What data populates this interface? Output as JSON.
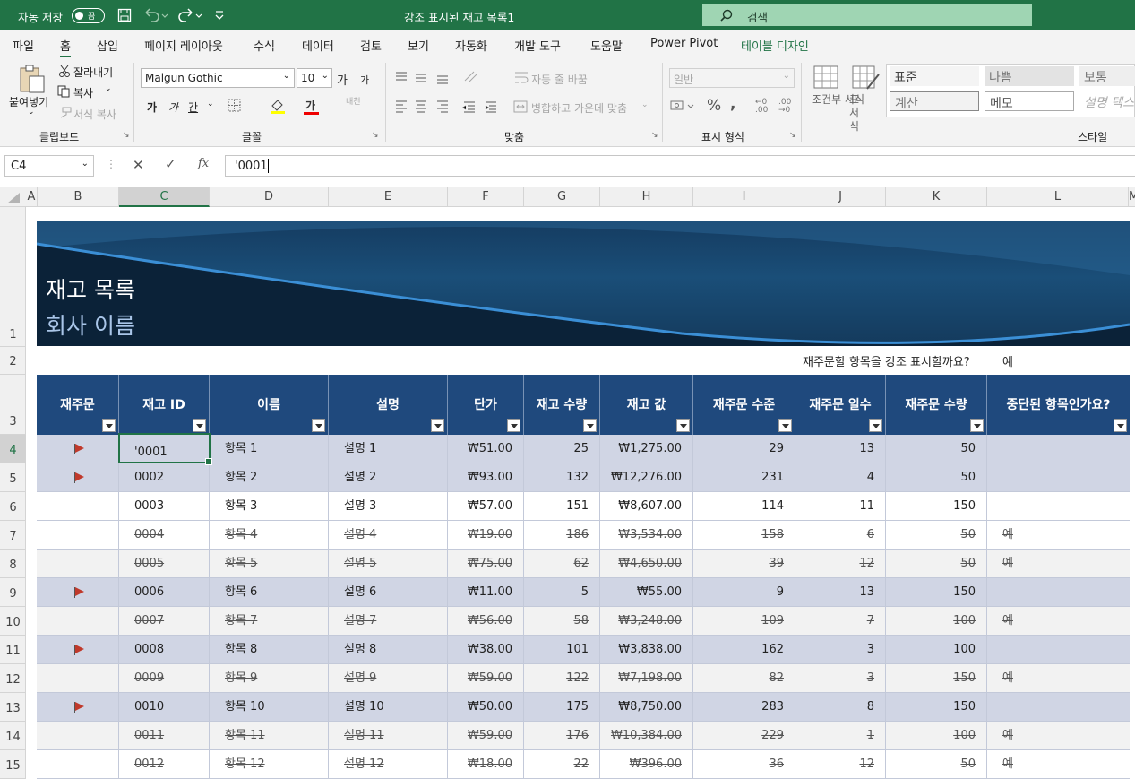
{
  "titlebar": {
    "autosave_label": "자동 저장",
    "autosave_state": "끔",
    "doc_title": "강조 표시된 재고 목록1",
    "search_placeholder": "검색"
  },
  "menu": [
    "파일",
    "홈",
    "삽입",
    "페이지 레이아웃",
    "수식",
    "데이터",
    "검토",
    "보기",
    "자동화",
    "개발 도구",
    "도움말",
    "Power Pivot",
    "테이블 디자인"
  ],
  "ribbon": {
    "clipboard": {
      "paste": "붙여넣기",
      "cut": "잘라내기",
      "copy": "복사",
      "format_painter": "서식 복사",
      "group": "클립보드"
    },
    "font": {
      "name": "Malgun Gothic",
      "size": "10",
      "grow": "가",
      "shrink": "가",
      "bold": "가",
      "italic": "가",
      "underline": "간",
      "font_color": "가",
      "phonetic": "내천",
      "group": "글꼴"
    },
    "alignment": {
      "wrap": "자동 줄 바꿈",
      "merge": "병합하고 가운데 맞춤",
      "group": "맞춤"
    },
    "number": {
      "format": "일반",
      "group": "표시 형식"
    },
    "styles": {
      "conditional": "조건부 서식",
      "table": "표 서식",
      "normal": "표준",
      "bad": "나쁨",
      "good": "보통",
      "calc": "계산",
      "memo": "메모",
      "explain": "설명 텍스",
      "group": "스타일"
    }
  },
  "formula_bar": {
    "name_box": "C4",
    "value": "'0001"
  },
  "columns": [
    "A",
    "B",
    "C",
    "D",
    "E",
    "F",
    "G",
    "H",
    "I",
    "J",
    "K",
    "L",
    "M"
  ],
  "rows": [
    "1",
    "2",
    "3",
    "4",
    "5",
    "6",
    "7",
    "8",
    "9",
    "10",
    "11",
    "12",
    "13",
    "14",
    "15"
  ],
  "banner": {
    "title": "재고 목록",
    "company": "회사 이름"
  },
  "highlight_prompt": {
    "question": "재주문할 항목을 강조 표시할까요?",
    "answer": "예"
  },
  "table": {
    "headers": [
      "재주문",
      "재고 ID",
      "이름",
      "설명",
      "단가",
      "재고 수량",
      "재고 값",
      "재주문 수준",
      "재주문 일수",
      "재주문 수량",
      "중단된 항목인가요?"
    ],
    "rows": [
      {
        "flag": true,
        "id": "'0001",
        "name": "항목 1",
        "desc": "설명 1",
        "price": "₩51.00",
        "qty": "25",
        "value": "₩1,275.00",
        "level": "29",
        "days": "13",
        "rqty": "50",
        "disc": "",
        "strike": false
      },
      {
        "flag": true,
        "id": "0002",
        "name": "항목 2",
        "desc": "설명 2",
        "price": "₩93.00",
        "qty": "132",
        "value": "₩12,276.00",
        "level": "231",
        "days": "4",
        "rqty": "50",
        "disc": "",
        "strike": false
      },
      {
        "flag": false,
        "id": "0003",
        "name": "항목 3",
        "desc": "설명 3",
        "price": "₩57.00",
        "qty": "151",
        "value": "₩8,607.00",
        "level": "114",
        "days": "11",
        "rqty": "150",
        "disc": "",
        "strike": false
      },
      {
        "flag": false,
        "id": "0004",
        "name": "항목 4",
        "desc": "설명 4",
        "price": "₩19.00",
        "qty": "186",
        "value": "₩3,534.00",
        "level": "158",
        "days": "6",
        "rqty": "50",
        "disc": "예",
        "strike": true
      },
      {
        "flag": false,
        "id": "0005",
        "name": "항목 5",
        "desc": "설명 5",
        "price": "₩75.00",
        "qty": "62",
        "value": "₩4,650.00",
        "level": "39",
        "days": "12",
        "rqty": "50",
        "disc": "예",
        "strike": true
      },
      {
        "flag": true,
        "id": "0006",
        "name": "항목 6",
        "desc": "설명 6",
        "price": "₩11.00",
        "qty": "5",
        "value": "₩55.00",
        "level": "9",
        "days": "13",
        "rqty": "150",
        "disc": "",
        "strike": false
      },
      {
        "flag": false,
        "id": "0007",
        "name": "항목 7",
        "desc": "설명 7",
        "price": "₩56.00",
        "qty": "58",
        "value": "₩3,248.00",
        "level": "109",
        "days": "7",
        "rqty": "100",
        "disc": "예",
        "strike": true
      },
      {
        "flag": true,
        "id": "0008",
        "name": "항목 8",
        "desc": "설명 8",
        "price": "₩38.00",
        "qty": "101",
        "value": "₩3,838.00",
        "level": "162",
        "days": "3",
        "rqty": "100",
        "disc": "",
        "strike": false
      },
      {
        "flag": false,
        "id": "0009",
        "name": "항목 9",
        "desc": "설명 9",
        "price": "₩59.00",
        "qty": "122",
        "value": "₩7,198.00",
        "level": "82",
        "days": "3",
        "rqty": "150",
        "disc": "예",
        "strike": true
      },
      {
        "flag": true,
        "id": "0010",
        "name": "항목 10",
        "desc": "설명 10",
        "price": "₩50.00",
        "qty": "175",
        "value": "₩8,750.00",
        "level": "283",
        "days": "8",
        "rqty": "150",
        "disc": "",
        "strike": false
      },
      {
        "flag": false,
        "id": "0011",
        "name": "항목 11",
        "desc": "설명 11",
        "price": "₩59.00",
        "qty": "176",
        "value": "₩10,384.00",
        "level": "229",
        "days": "1",
        "rqty": "100",
        "disc": "예",
        "strike": true
      },
      {
        "flag": false,
        "id": "0012",
        "name": "항목 12",
        "desc": "설명 12",
        "price": "₩18.00",
        "qty": "22",
        "value": "₩396.00",
        "level": "36",
        "days": "12",
        "rqty": "50",
        "disc": "예",
        "strike": true
      }
    ]
  }
}
